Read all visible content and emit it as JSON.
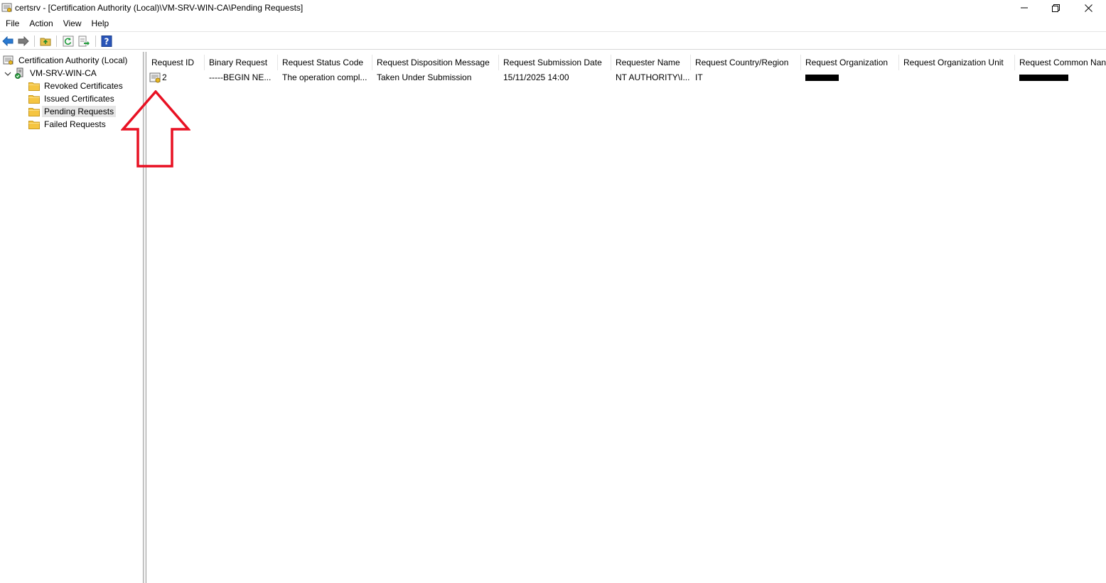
{
  "window": {
    "title": "certsrv - [Certification Authority (Local)\\VM-SRV-WIN-CA\\Pending Requests]",
    "minimize_glyph": "—",
    "restore_glyph": "❐",
    "close_glyph": "✕"
  },
  "menu": {
    "file": "File",
    "action": "Action",
    "view": "View",
    "help": "Help"
  },
  "toolbar": {
    "icons": [
      "back-icon",
      "forward-icon",
      "up-folder-icon",
      "refresh-icon",
      "export-list-icon",
      "help-icon"
    ]
  },
  "tree": {
    "root": "Certification Authority (Local)",
    "ca": "VM-SRV-WIN-CA",
    "items": [
      {
        "label": "Revoked Certificates"
      },
      {
        "label": "Issued Certificates"
      },
      {
        "label": "Pending Requests",
        "selected": true
      },
      {
        "label": "Failed Requests"
      }
    ]
  },
  "list": {
    "columns": [
      "Request ID",
      "Binary Request",
      "Request Status Code",
      "Request Disposition Message",
      "Request Submission Date",
      "Requester Name",
      "Request Country/Region",
      "Request Organization",
      "Request Organization Unit",
      "Request Common Nan"
    ],
    "rows": [
      {
        "request_id": "2",
        "binary_request": "-----BEGIN NE...",
        "status_code": "The operation compl...",
        "disposition": "Taken Under Submission",
        "submission_date": "15/11/2025 14:00",
        "requester": "NT AUTHORITY\\I...",
        "country": "IT",
        "organization": "[redacted]",
        "org_unit": "",
        "common_name": "[redacted]"
      }
    ]
  },
  "colors": {
    "annotation_arrow": "#e81123",
    "selection": "#e5e5e5",
    "folder": "#f5c542"
  }
}
